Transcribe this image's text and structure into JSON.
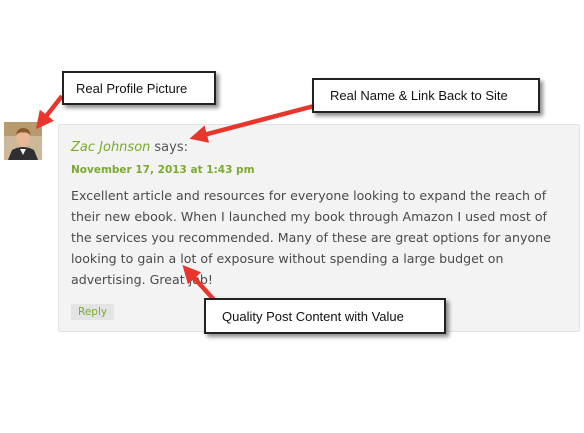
{
  "comment": {
    "author": "Zac Johnson",
    "says": "says:",
    "date": "November 17, 2013 at 1:43 pm",
    "body": "Excellent article and resources for everyone looking to expand the reach of their new ebook. When I launched my book through Amazon I used most of the services you recommended. Many of these are great options for anyone looking to gain a lot of exposure without spending a large budget on advertising. Great job!",
    "reply_label": "Reply"
  },
  "callouts": {
    "profile": "Real Profile Picture",
    "name": "Real Name & Link Back to Site",
    "content": "Quality Post Content with Value"
  },
  "colors": {
    "accent_green": "#7aaa2e",
    "arrow_red": "#e8362c",
    "box_background": "#f3f3f3"
  }
}
